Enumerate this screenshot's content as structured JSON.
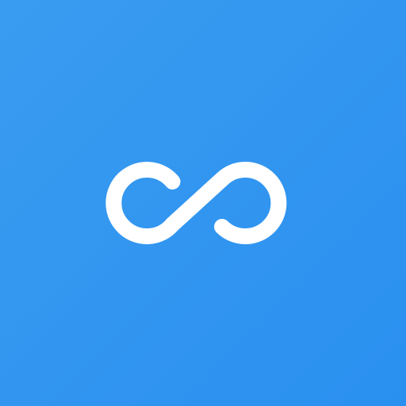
{
  "app_icon": {
    "background_color_start": "#3a9cf0",
    "background_color_end": "#2a90f0",
    "logo": {
      "icon": "infinity-icon",
      "color": "#ffffff"
    }
  }
}
